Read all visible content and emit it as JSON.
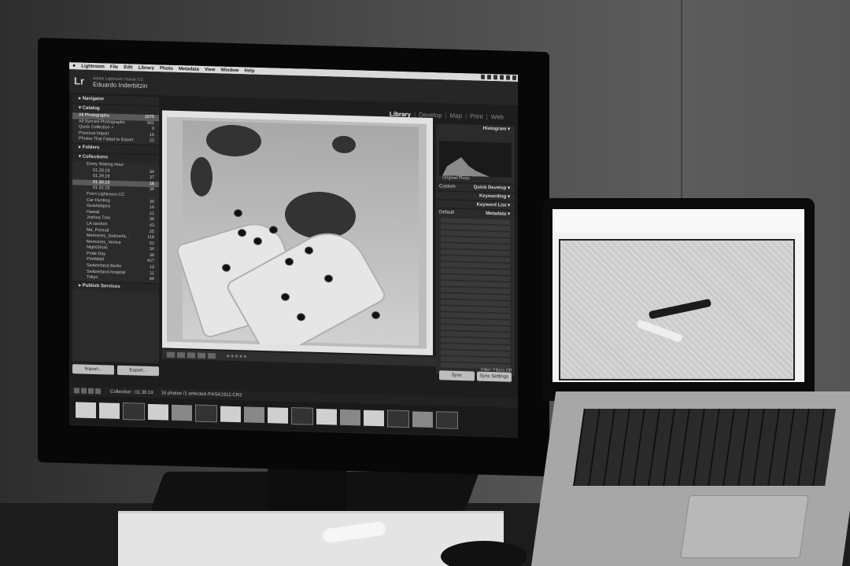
{
  "menubar": {
    "items": [
      "Lightroom",
      "File",
      "Edit",
      "Library",
      "Photo",
      "Metadata",
      "View",
      "Window",
      "Help"
    ]
  },
  "header": {
    "logo": "Lr",
    "app_name": "Adobe Lightroom Classic CC",
    "user_name": "Eduardo Inderbitzin"
  },
  "modules": [
    "Library",
    "Develop",
    "Map",
    "Print",
    "Web"
  ],
  "left_panel": {
    "navigator": "Navigator",
    "catalog": {
      "title": "Catalog",
      "items": [
        {
          "label": "All Photographs",
          "count": "1075"
        },
        {
          "label": "All Synced Photographs",
          "count": "941"
        },
        {
          "label": "Quick Collection +",
          "count": "0"
        },
        {
          "label": "Previous Import",
          "count": "16"
        },
        {
          "label": "Photos That Failed to Export",
          "count": "22"
        }
      ]
    },
    "folders": "Folders",
    "collections": {
      "title": "Collections",
      "items": [
        {
          "label": "Every Waking Hour",
          "count": ""
        },
        {
          "label": "01.28.19",
          "count": "34"
        },
        {
          "label": "01.29.19",
          "count": "37"
        },
        {
          "label": "01.30.19",
          "count": "16"
        },
        {
          "label": "01.31.19",
          "count": "36"
        },
        {
          "label": "From Lightroom CC",
          "count": ""
        },
        {
          "label": "Car-Hunting",
          "count": "30"
        },
        {
          "label": "Guadalajara",
          "count": "16"
        },
        {
          "label": "Hawaii",
          "count": "21"
        },
        {
          "label": "Joshua Tree",
          "count": "36"
        },
        {
          "label": "LA random",
          "count": "43"
        },
        {
          "label": "Me_Portrait",
          "count": "25"
        },
        {
          "label": "Memories_Switzerla...",
          "count": "118"
        },
        {
          "label": "Memories_Venice",
          "count": "52"
        },
        {
          "label": "NightShots",
          "count": "34"
        },
        {
          "label": "Pride Day",
          "count": "38"
        },
        {
          "label": "PrintWall",
          "count": "427"
        },
        {
          "label": "Switzerland-Berlin",
          "count": "13"
        },
        {
          "label": "Switzerland-hospital",
          "count": "11"
        },
        {
          "label": "Tokyo",
          "count": "66"
        }
      ]
    },
    "publish": "Publish Services",
    "import_label": "Import...",
    "export_label": "Export..."
  },
  "right_panel": {
    "histogram": "Histogram",
    "original_photo": "Original Photo",
    "quick_develop": "Quick Develop",
    "keywording": "Keywording",
    "keyword_list": "Keyword List",
    "metadata": "Metadata",
    "custom": "Custom",
    "default": "Default",
    "sync": "Sync",
    "sync_settings": "Sync Settings",
    "filter": "Filter:",
    "filter_value": "Filters Off"
  },
  "filmstrip": {
    "collection": "Collection : 01.30.19",
    "info": "16 photos /1 selected /FASA1912.CR2"
  }
}
